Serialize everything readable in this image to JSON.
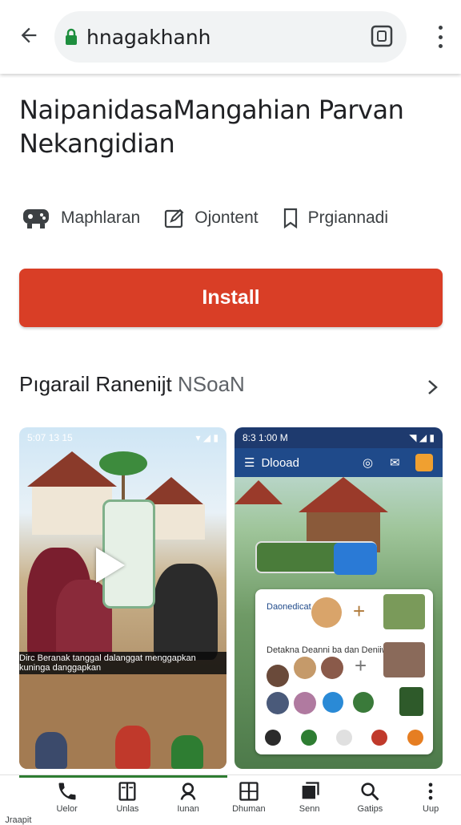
{
  "browser": {
    "url": "hnagakhanh"
  },
  "app": {
    "title": "NaipanidasaMangahian Parvan Nekangidian",
    "meta": [
      {
        "label": "Maphlaran",
        "icon": "controller-icon"
      },
      {
        "label": "Ojontent",
        "icon": "edit-icon"
      },
      {
        "label": "Prgiannadi",
        "icon": "bookmark-icon"
      }
    ],
    "install_label": "Install"
  },
  "section": {
    "title": "Pıgarail Ranenijt",
    "subtitle": "NSoaN"
  },
  "screenshots": [
    {
      "status_time": "5:07 13 15",
      "caption": "Dirc Beranak tanggal dalanggat menggapkan kuninga danggapkan"
    },
    {
      "status_time": "8:3 1:00 M",
      "appbar_title": "Dlooad",
      "card_title": "Daonedicat",
      "card_row": "Detakna Deanni ba dan Deniiwa"
    }
  ],
  "bottom_nav": [
    {
      "label": "Jraapit",
      "icon": "phone-icon"
    },
    {
      "label": "Uelor",
      "icon": "book-icon"
    },
    {
      "label": "Unlas",
      "icon": "person-icon"
    },
    {
      "label": "Iunan",
      "icon": "window-icon"
    },
    {
      "label": "Dhuman",
      "icon": "library-icon"
    },
    {
      "label": "Senn",
      "icon": "folder-icon"
    },
    {
      "label": "Gatips",
      "icon": "search-icon"
    },
    {
      "label": "Uup",
      "icon": "more-vert-icon"
    }
  ],
  "colors": {
    "accent": "#d93e26",
    "nav_indicator": "#2e7d32",
    "lock": "#1e8e3e"
  }
}
